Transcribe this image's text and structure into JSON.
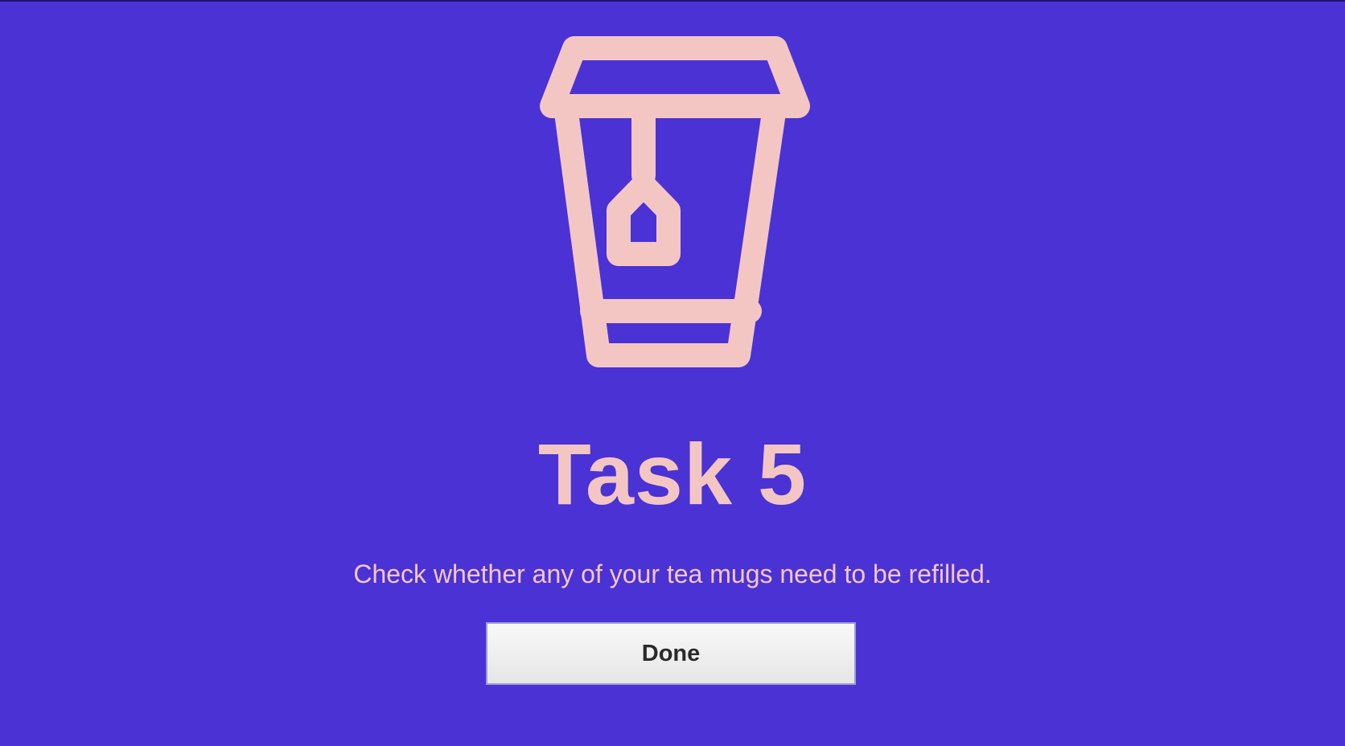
{
  "screen": {
    "title": "Task 5",
    "message": "Check whether any of your tea mugs need to be refilled.",
    "done_label": "Done"
  },
  "icon": {
    "name": "tea-cup-icon"
  },
  "colors": {
    "background": "#4a32d5",
    "accent": "#f4c6c3",
    "button_text": "#2a2a2a",
    "button_border": "#9b9bd6"
  }
}
